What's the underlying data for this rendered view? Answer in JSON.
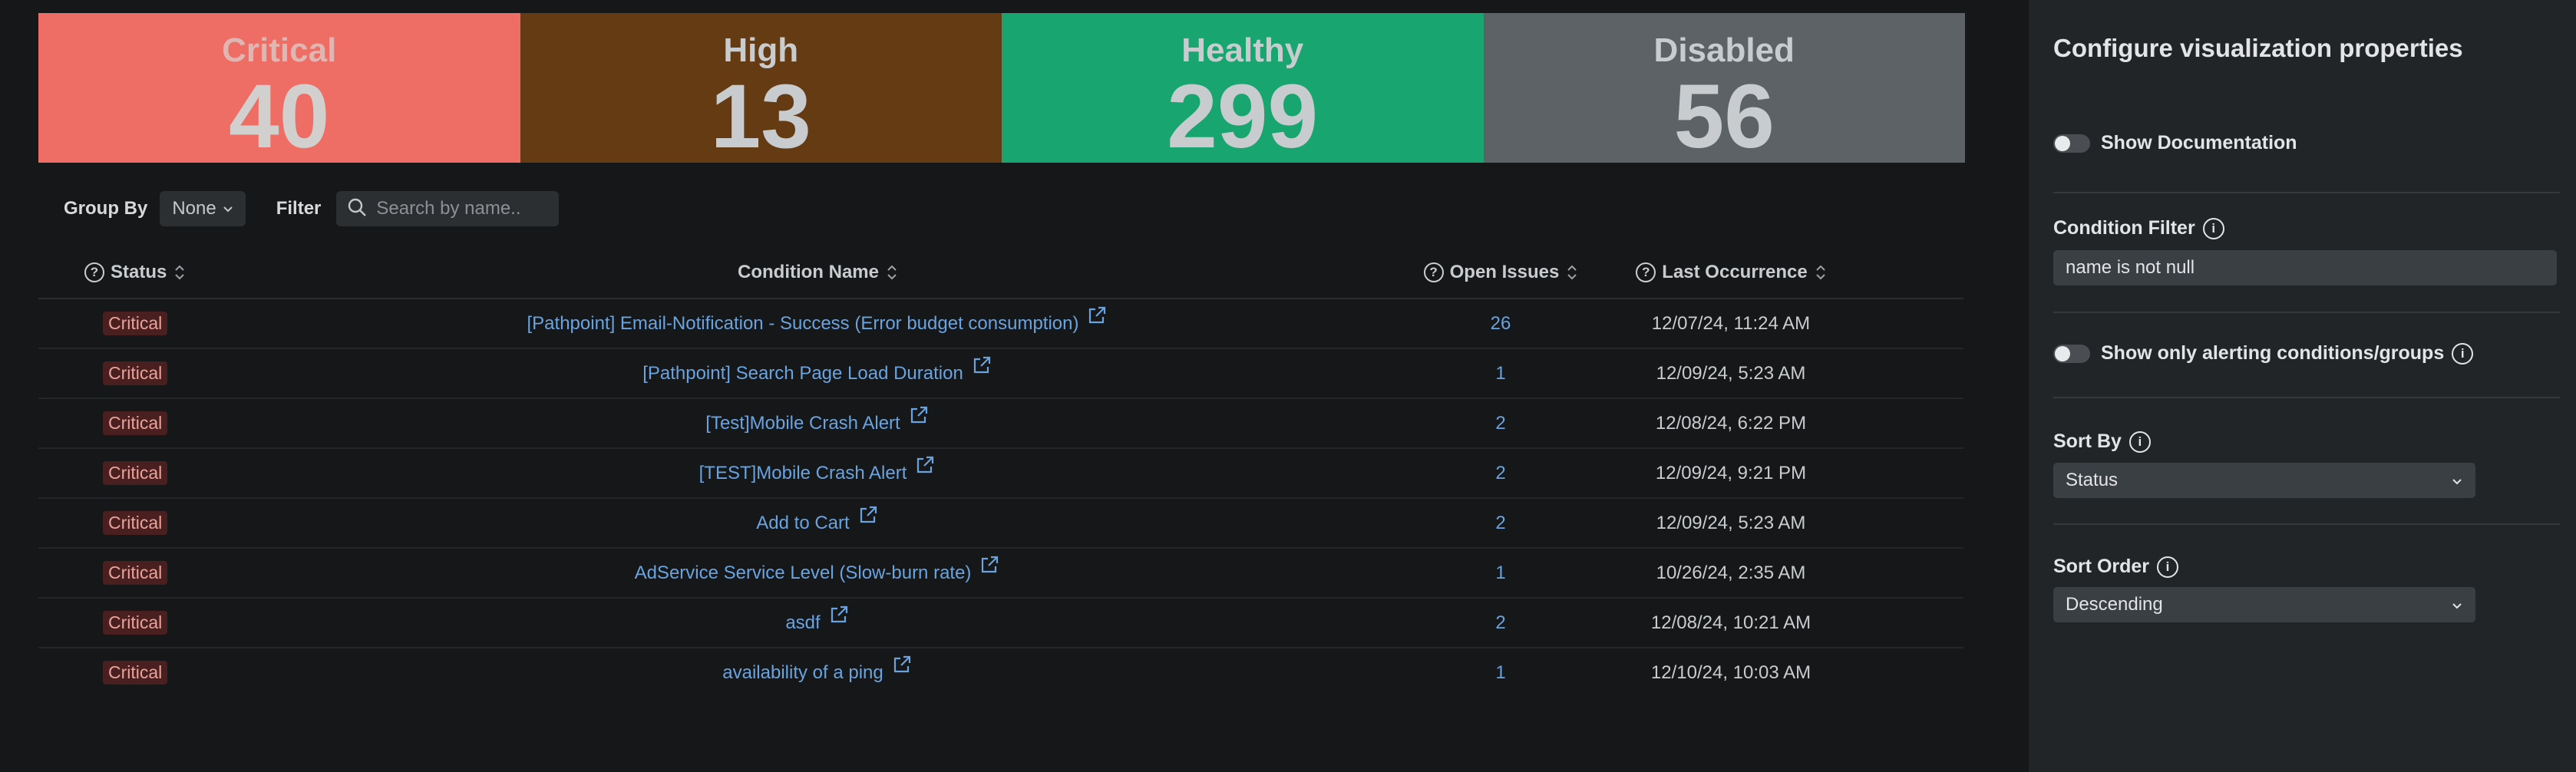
{
  "summary": {
    "critical": {
      "label": "Critical",
      "value": "40"
    },
    "high": {
      "label": "High",
      "value": "13"
    },
    "healthy": {
      "label": "Healthy",
      "value": "299"
    },
    "disabled": {
      "label": "Disabled",
      "value": "56"
    }
  },
  "toolbar": {
    "group_by_label": "Group By",
    "group_by_value": "None",
    "filter_label": "Filter",
    "search_placeholder": "Search by name.."
  },
  "table": {
    "headers": {
      "status": "Status",
      "condition_name": "Condition Name",
      "open_issues": "Open Issues",
      "last_occurrence": "Last Occurrence"
    },
    "rows": [
      {
        "status": "Critical",
        "name": "[Pathpoint] Email-Notification - Success (Error budget consumption)",
        "issues": "26",
        "last": "12/07/24, 11:24 AM"
      },
      {
        "status": "Critical",
        "name": "[Pathpoint] Search Page Load Duration",
        "issues": "1",
        "last": "12/09/24, 5:23 AM"
      },
      {
        "status": "Critical",
        "name": "[Test]Mobile Crash Alert",
        "issues": "2",
        "last": "12/08/24, 6:22 PM"
      },
      {
        "status": "Critical",
        "name": "[TEST]Mobile Crash Alert",
        "issues": "2",
        "last": "12/09/24, 9:21 PM"
      },
      {
        "status": "Critical",
        "name": "Add to Cart",
        "issues": "2",
        "last": "12/09/24, 5:23 AM"
      },
      {
        "status": "Critical",
        "name": "AdService Service Level (Slow-burn rate)",
        "issues": "1",
        "last": "10/26/24, 2:35 AM"
      },
      {
        "status": "Critical",
        "name": "asdf",
        "issues": "2",
        "last": "12/08/24, 10:21 AM"
      },
      {
        "status": "Critical",
        "name": "availability of a ping",
        "issues": "1",
        "last": "12/10/24, 10:03 AM"
      }
    ]
  },
  "panel": {
    "title": "Configure visualization properties",
    "show_documentation": "Show Documentation",
    "condition_filter_label": "Condition Filter",
    "condition_filter_value": "name is not null",
    "show_only_alerting": "Show only alerting conditions/groups",
    "sort_by_label": "Sort By",
    "sort_by_value": "Status",
    "sort_order_label": "Sort Order",
    "sort_order_value": "Descending"
  },
  "colors": {
    "critical": "#ee6d64",
    "high": "#653b13",
    "healthy": "#18a56f",
    "disabled": "#5d6267",
    "link": "#69a3e0"
  }
}
